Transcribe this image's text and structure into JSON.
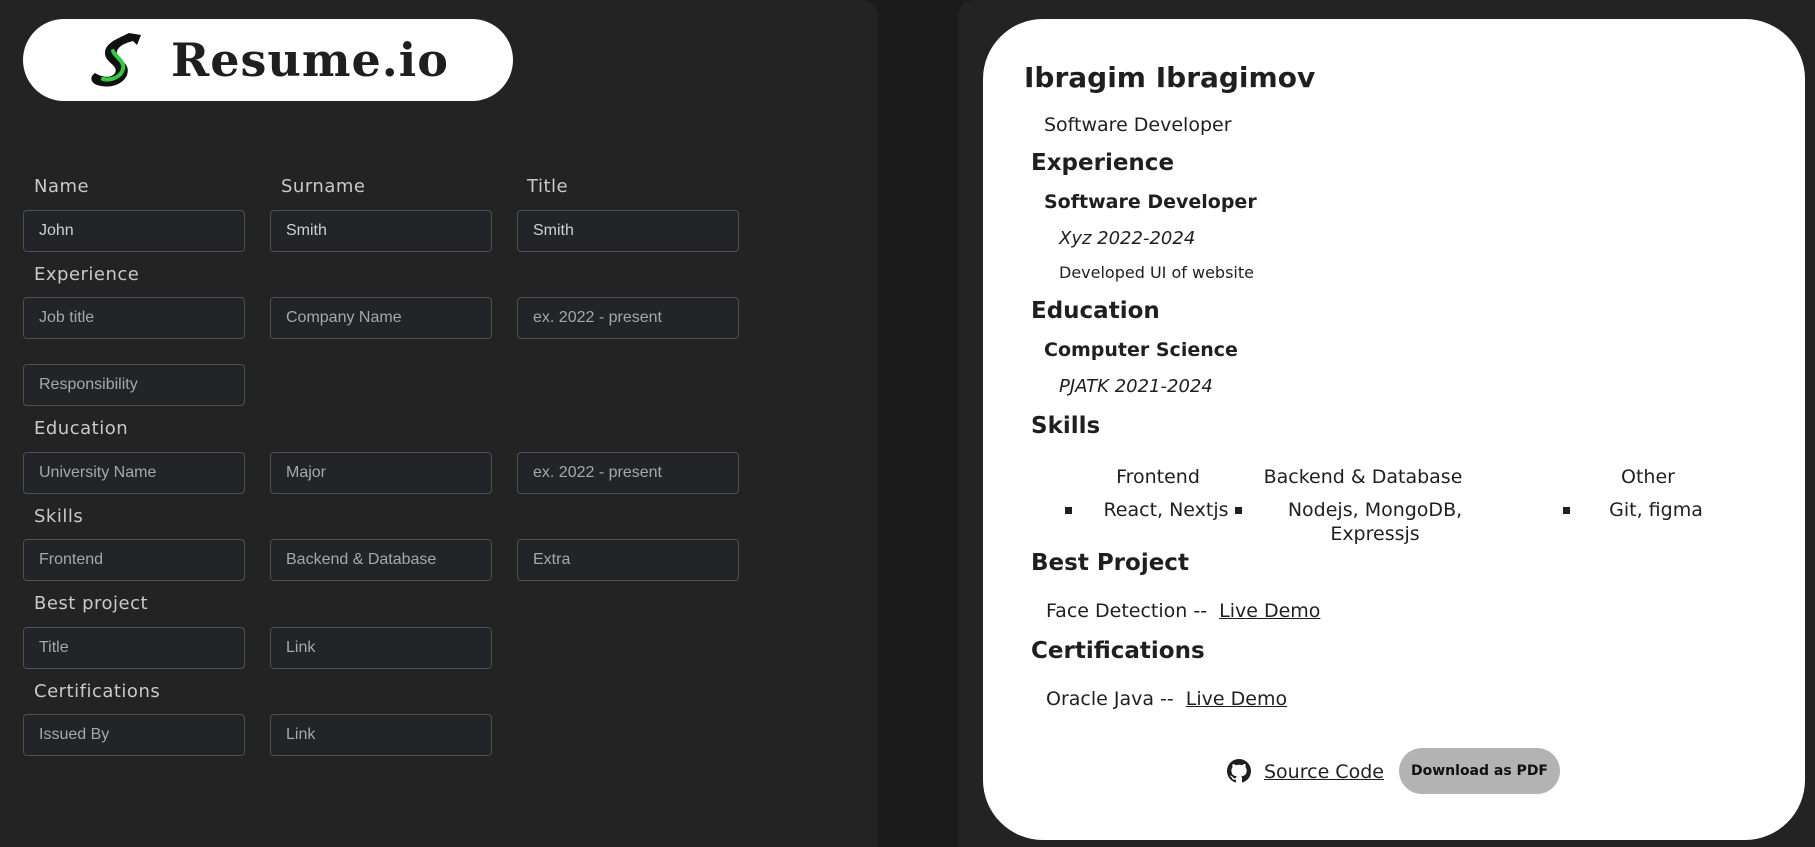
{
  "app": {
    "logo_text": "Resume.io",
    "logo_icon": "s-arrow-logo-icon"
  },
  "form": {
    "labels": {
      "name": "Name",
      "surname": "Surname",
      "title": "Title",
      "experience": "Experience",
      "education": "Education",
      "skills": "Skills",
      "best_project": "Best project",
      "certifications": "Certifications"
    },
    "fields": {
      "name_value": "John",
      "surname_value": "Smith",
      "title_value": "Smith",
      "job_title_placeholder": "Job title",
      "company_placeholder": "Company Name",
      "exp_years_placeholder": "ex. 2022 - present",
      "responsibility_placeholder": "Responsibility",
      "university_placeholder": "University Name",
      "major_placeholder": "Major",
      "edu_years_placeholder": "ex. 2022 - present",
      "frontend_placeholder": "Frontend",
      "backend_placeholder": "Backend & Database",
      "extra_placeholder": "Extra",
      "project_title_placeholder": "Title",
      "project_link_placeholder": "Link",
      "issued_by_placeholder": "Issued By",
      "cert_link_placeholder": "Link"
    }
  },
  "resume": {
    "name": "Ibragim Ibragimov",
    "role": "Software Developer",
    "experience_heading": "Experience",
    "experience": {
      "job_title": "Software Developer",
      "company_years": "Xyz 2022-2024",
      "responsibility": "Developed UI of website"
    },
    "education_heading": "Education",
    "education": {
      "major": "Computer Science",
      "school_years": "PJATK 2021-2024"
    },
    "skills_heading": "Skills",
    "skills": {
      "frontend_head": "Frontend",
      "frontend_item": "React, Nextjs",
      "backend_head": "Backend & Database",
      "backend_item_line1": "Nodejs, MongoDB,",
      "backend_item_line2": "Expressjs",
      "other_head": "Other",
      "other_item": "Git, figma"
    },
    "best_project_heading": "Best Project",
    "best_project": {
      "title": "Face Detection --",
      "link": "Live Demo"
    },
    "certifications_heading": "Certifications",
    "certification": {
      "title": "Oracle Java --",
      "link": "Live Demo"
    },
    "footer": {
      "source_code": "Source Code",
      "github_icon": "github-icon",
      "download_label": "Download as PDF",
      "download_bg": "#b3b3b3"
    }
  }
}
